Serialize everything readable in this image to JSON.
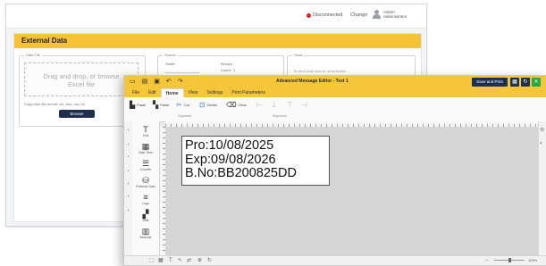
{
  "back": {
    "status": "Disconnected",
    "change": "Change",
    "user_name": "Admin",
    "user_role": "Administrator",
    "section_title": "External Data",
    "data_file_legend": "Data File",
    "drop_text_1": "Drag and drop, or browse",
    "drop_text_2": "Excel file",
    "supported_text": "Supported file format: xls, xlsx, csv, txt",
    "browse_label": "Browse",
    "source_legend": "Source",
    "sheet_label": "Sheet",
    "record_label": "Record",
    "count_label": "Count:",
    "count_value": "1",
    "send_legend": "Send",
    "send_placeholder": "To send data click on send button"
  },
  "app": {
    "title": "Advanced Message Editor - Text 1",
    "save_print_label": "Save and Print",
    "menu": [
      "File",
      "Edit",
      "Home",
      "View",
      "Settings",
      "Print Parameters"
    ],
    "active_menu": "Home",
    "ribbon": {
      "paste": "Paste",
      "copy": "Paste",
      "cut": "Cut",
      "delete": "Delete",
      "clear": "Clear",
      "clipboard_group": "Clipboard",
      "alignment_group": "Alignment"
    },
    "tools": [
      "Text",
      "Date Time",
      "Counter",
      "External Data",
      "Logo",
      "Shift",
      "Barcode"
    ],
    "label_lines": [
      "Pro:10/08/2025",
      "Exp:09/08/2026",
      "B.No:BB200825DD"
    ],
    "zoom": "100%"
  },
  "colors": {
    "accent": "#f6c63a",
    "navy": "#1e2f50",
    "green": "#27a844",
    "disconnected": "#e02020"
  }
}
